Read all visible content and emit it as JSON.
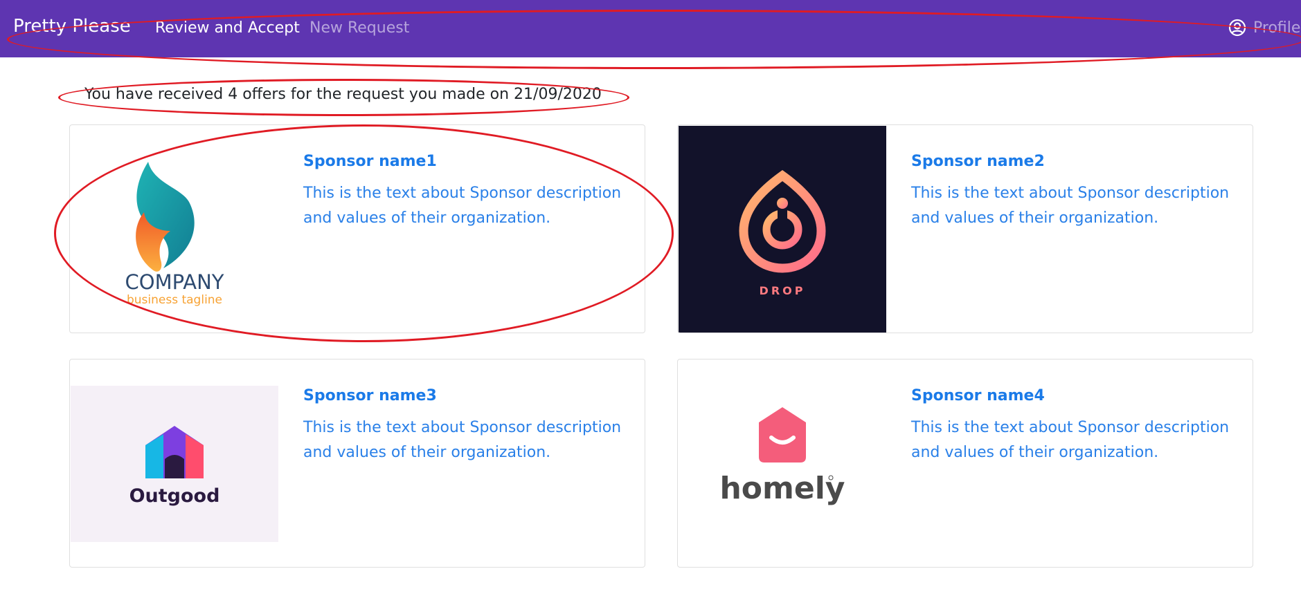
{
  "navbar": {
    "brand": "Pretty Please",
    "links": [
      {
        "label": "Review and Accept"
      },
      {
        "label": "New Request"
      }
    ],
    "profile_label": "Profile",
    "profile_icon": "user-circle-icon",
    "bg_color": "#5e35b1"
  },
  "summary": {
    "text": "You have received 4 offers for the request you made on 21/09/2020"
  },
  "offers": [
    {
      "name": "Sponsor name1",
      "description": "This is the text about Sponsor description and values of their organization.",
      "logo": {
        "wordmark": "COMPANY",
        "tagline": "business tagline",
        "icon": "flame-logo-icon"
      }
    },
    {
      "name": "Sponsor name2",
      "description": "This is the text about Sponsor description and values of their organization.",
      "logo": {
        "wordmark": "DROP",
        "icon": "drop-logo-icon"
      }
    },
    {
      "name": "Sponsor name3",
      "description": "This is the text about Sponsor description and values of their organization.",
      "logo": {
        "wordmark": "Outgood",
        "icon": "house-logo-icon"
      }
    },
    {
      "name": "Sponsor name4",
      "description": "This is the text about Sponsor description and values of their organization.",
      "logo": {
        "wordmark": "homely",
        "icon": "smile-house-logo-icon"
      }
    }
  ],
  "colors": {
    "accent": "#1a7ae8",
    "annotation": "#e01b24"
  }
}
